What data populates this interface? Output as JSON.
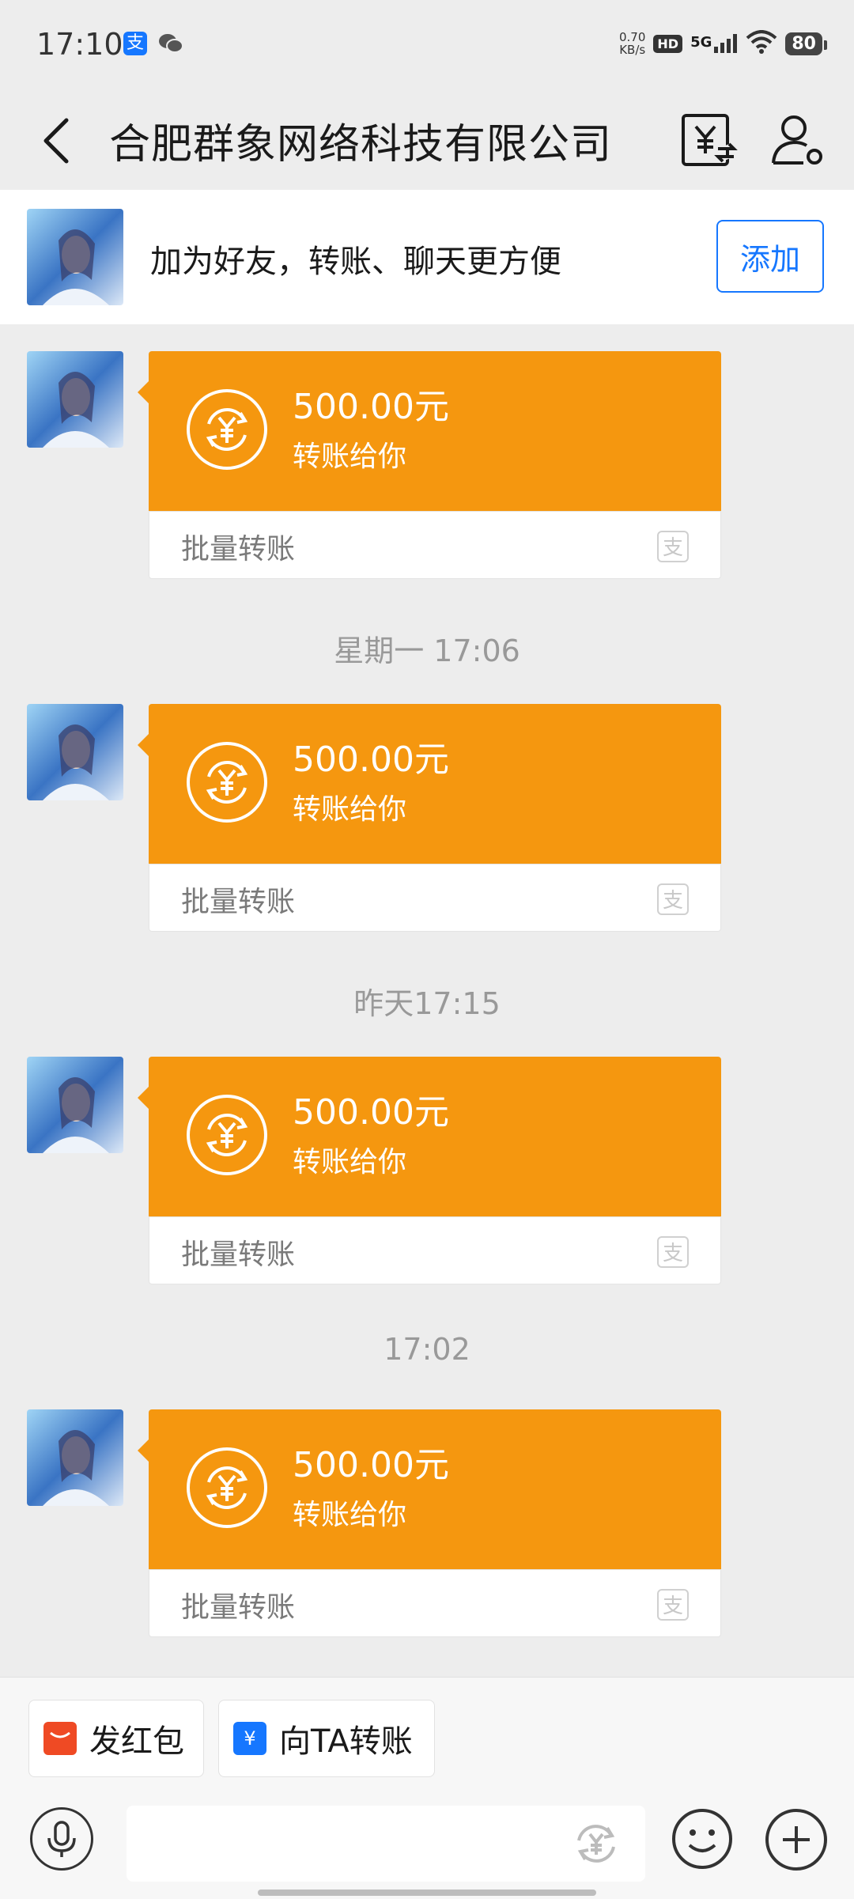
{
  "status_bar": {
    "time": "17:10",
    "apps": [
      "alipay-icon",
      "wechat-icon"
    ],
    "net_speed_value": "0.70",
    "net_speed_unit": "KB/s",
    "hd_label": "HD",
    "network": "5G",
    "battery": "80"
  },
  "header": {
    "title": "合肥群象网络科技有限公司",
    "icons": [
      "back-icon",
      "bill-icon",
      "profile-settings-icon"
    ]
  },
  "banner": {
    "text": "加为好友，转账、聊天更方便",
    "add_label": "添加"
  },
  "messages": [
    {
      "amount": "500.00元",
      "subtitle": "转账给你",
      "footer": "批量转账"
    },
    {
      "amount": "500.00元",
      "subtitle": "转账给你",
      "footer": "批量转账"
    },
    {
      "amount": "500.00元",
      "subtitle": "转账给你",
      "footer": "批量转账"
    },
    {
      "amount": "500.00元",
      "subtitle": "转账给你",
      "footer": "批量转账"
    }
  ],
  "timestamps": [
    "星期一 17:06",
    "昨天17:15",
    "17:02"
  ],
  "quick_actions": {
    "red_packet": "发红包",
    "transfer": "向TA转账"
  },
  "input": {
    "placeholder": ""
  },
  "colors": {
    "transfer_orange": "#f5970f",
    "alipay_blue": "#1677ff",
    "background": "#ededed"
  }
}
